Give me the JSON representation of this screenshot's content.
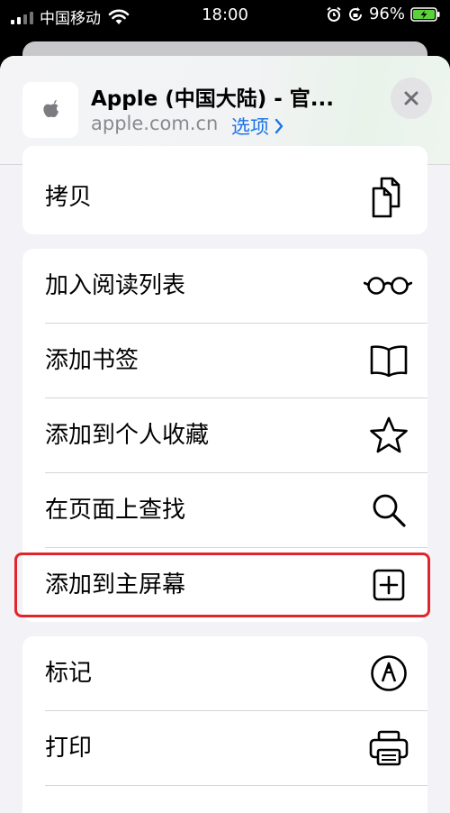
{
  "status_bar": {
    "carrier": "中国移动",
    "time": "18:00",
    "battery": "96%"
  },
  "header": {
    "title": "Apple (中国大陆) - 官...",
    "domain": "apple.com.cn",
    "options_label": "选项",
    "icon": "apple-logo-icon"
  },
  "menu": {
    "copy": {
      "label": "拷贝",
      "icon": "copy-icon"
    },
    "reading_list": {
      "label": "加入阅读列表",
      "icon": "glasses-icon"
    },
    "bookmark": {
      "label": "添加书签",
      "icon": "book-icon"
    },
    "favorites": {
      "label": "添加到个人收藏",
      "icon": "star-icon"
    },
    "find": {
      "label": "在页面上查找",
      "icon": "search-icon"
    },
    "home_screen": {
      "label": "添加到主屏幕",
      "icon": "plus-square-icon"
    },
    "markup": {
      "label": "标记",
      "icon": "markup-pen-icon"
    },
    "print": {
      "label": "打印",
      "icon": "printer-icon"
    }
  },
  "colors": {
    "accent": "#1a73e8",
    "highlight": "#e0262b",
    "battery_fill": "#5ad13b"
  }
}
